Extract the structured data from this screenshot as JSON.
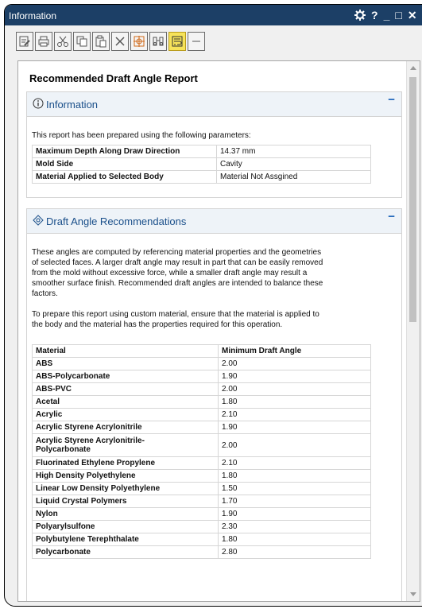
{
  "window": {
    "title": "Information"
  },
  "title_controls": {
    "settings": "⚙",
    "help": "?",
    "minimize": "_",
    "maximize": "□",
    "close": "✕"
  },
  "toolbar": {
    "buttons": [
      {
        "icon": "edit-document-icon"
      },
      {
        "icon": "print-icon"
      },
      {
        "icon": "cut-icon"
      },
      {
        "icon": "copy-icon"
      },
      {
        "icon": "paste-icon"
      },
      {
        "icon": "delete-icon"
      },
      {
        "icon": "target-icon"
      },
      {
        "icon": "binoculars-icon"
      },
      {
        "icon": "word-wrap-icon",
        "active": true
      },
      {
        "icon": "minus-icon"
      }
    ]
  },
  "report": {
    "title": "Recommended Draft Angle Report",
    "info": {
      "title": "Information",
      "collapse": "−",
      "intro": "This report has been prepared using the following parameters:",
      "rows": [
        {
          "key": "Maximum Depth Along Draw Direction",
          "value": "14.37 mm"
        },
        {
          "key": "Mold Side",
          "value": "Cavity"
        },
        {
          "key": "Material Applied to Selected Body",
          "value": "Material Not Assgined"
        }
      ]
    },
    "draft": {
      "title": "Draft Angle Recommendations",
      "collapse": "−",
      "para1_lines": [
        "These angles are computed by referencing material properties and the geometries",
        "of selected faces. A larger draft angle may result in part that can be easily removed",
        "from the mold without excessive force, while a smaller draft angle may result a",
        "smoother surface finish. Recommended draft angles are intended to balance these",
        "factors."
      ],
      "para2_lines": [
        "To prepare this report using custom material, ensure that the material is applied to",
        "the body and the material has the properties required for this operation."
      ],
      "header": {
        "material": "Material",
        "angle": "Minimum Draft Angle"
      },
      "materials": [
        {
          "material": "ABS",
          "angle": "2.00"
        },
        {
          "material": "ABS-Polycarbonate",
          "angle": "1.90"
        },
        {
          "material": "ABS-PVC",
          "angle": "2.00"
        },
        {
          "material": "Acetal",
          "angle": "1.80"
        },
        {
          "material": "Acrylic",
          "angle": "2.10"
        },
        {
          "material": "Acrylic Styrene Acrylonitrile",
          "angle": "1.90"
        },
        {
          "material": "Acrylic Styrene Acrylonitrile-",
          "material2": "Polycarbonate",
          "angle": "2.00"
        },
        {
          "material": "Fluorinated Ethylene Propylene",
          "angle": "2.10"
        },
        {
          "material": "High Density Polyethylene",
          "angle": "1.80"
        },
        {
          "material": "Linear Low Density Polyethylene",
          "angle": "1.50"
        },
        {
          "material": "Liquid Crystal Polymers",
          "angle": "1.70"
        },
        {
          "material": "Nylon",
          "angle": "1.90"
        },
        {
          "material": "Polyarylsulfone",
          "angle": "2.30"
        },
        {
          "material": "Polybutylene Terephthalate",
          "angle": "1.80"
        },
        {
          "material": "Polycarbonate",
          "angle": "2.80"
        }
      ]
    }
  }
}
